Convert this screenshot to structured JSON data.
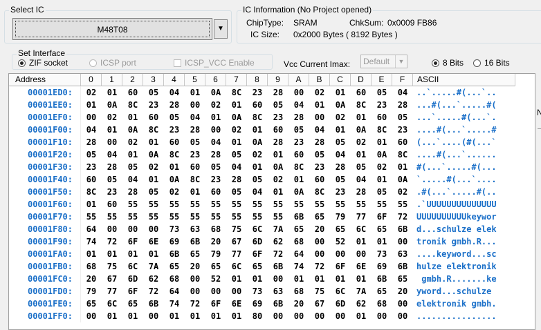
{
  "select_ic": {
    "title": "Select IC",
    "value": "M48T08",
    "dropdown_arrow": "▼"
  },
  "ic_info": {
    "title": "IC Information (No Project opened)",
    "chip_type_label": "ChipType:",
    "chip_type_value": "SRAM",
    "chksum_label": "ChkSum:",
    "chksum_value": "0x0009 FB86",
    "ic_size_label": "IC Size:",
    "ic_size_value": "0x2000 Bytes ( 8192 Bytes )"
  },
  "set_interface": {
    "title": "Set Interface",
    "zif_socket": "ZIF socket",
    "icsp_port": "ICSP port",
    "icsp_vcc": "ICSP_VCC Enable"
  },
  "vcc": {
    "label": "Vcc Current Imax:",
    "value": "Default"
  },
  "bits": {
    "bits8": "8 Bits",
    "bits16": "16 Bits"
  },
  "grid": {
    "header_address": "Address",
    "header_cols": [
      "0",
      "1",
      "2",
      "3",
      "4",
      "5",
      "6",
      "7",
      "8",
      "9",
      "A",
      "B",
      "C",
      "D",
      "E",
      "F"
    ],
    "header_ascii": "ASCII",
    "rows": [
      {
        "addr": "00001ED0:",
        "bytes": [
          "02",
          "01",
          "60",
          "05",
          "04",
          "01",
          "0A",
          "8C",
          "23",
          "28",
          "00",
          "02",
          "01",
          "60",
          "05",
          "04"
        ],
        "ascii": "..`.....#(...`.."
      },
      {
        "addr": "00001EE0:",
        "bytes": [
          "01",
          "0A",
          "8C",
          "23",
          "28",
          "00",
          "02",
          "01",
          "60",
          "05",
          "04",
          "01",
          "0A",
          "8C",
          "23",
          "28"
        ],
        "ascii": "...#(...`.....#("
      },
      {
        "addr": "00001EF0:",
        "bytes": [
          "00",
          "02",
          "01",
          "60",
          "05",
          "04",
          "01",
          "0A",
          "8C",
          "23",
          "28",
          "00",
          "02",
          "01",
          "60",
          "05"
        ],
        "ascii": "...`.....#(...`."
      },
      {
        "addr": "00001F00:",
        "bytes": [
          "04",
          "01",
          "0A",
          "8C",
          "23",
          "28",
          "00",
          "02",
          "01",
          "60",
          "05",
          "04",
          "01",
          "0A",
          "8C",
          "23"
        ],
        "ascii": "....#(...`.....#"
      },
      {
        "addr": "00001F10:",
        "bytes": [
          "28",
          "00",
          "02",
          "01",
          "60",
          "05",
          "04",
          "01",
          "0A",
          "28",
          "23",
          "28",
          "05",
          "02",
          "01",
          "60"
        ],
        "ascii": "(...`....(#(...`"
      },
      {
        "addr": "00001F20:",
        "bytes": [
          "05",
          "04",
          "01",
          "0A",
          "8C",
          "23",
          "28",
          "05",
          "02",
          "01",
          "60",
          "05",
          "04",
          "01",
          "0A",
          "8C"
        ],
        "ascii": "....#(...`......"
      },
      {
        "addr": "00001F30:",
        "bytes": [
          "23",
          "28",
          "05",
          "02",
          "01",
          "60",
          "05",
          "04",
          "01",
          "0A",
          "8C",
          "23",
          "28",
          "05",
          "02",
          "01"
        ],
        "ascii": "#(...`.....#(..."
      },
      {
        "addr": "00001F40:",
        "bytes": [
          "60",
          "05",
          "04",
          "01",
          "0A",
          "8C",
          "23",
          "28",
          "05",
          "02",
          "01",
          "60",
          "05",
          "04",
          "01",
          "0A"
        ],
        "ascii": "`.....#(...`...."
      },
      {
        "addr": "00001F50:",
        "bytes": [
          "8C",
          "23",
          "28",
          "05",
          "02",
          "01",
          "60",
          "05",
          "04",
          "01",
          "0A",
          "8C",
          "23",
          "28",
          "05",
          "02"
        ],
        "ascii": ".#(...`.....#(.."
      },
      {
        "addr": "00001F60:",
        "bytes": [
          "01",
          "60",
          "55",
          "55",
          "55",
          "55",
          "55",
          "55",
          "55",
          "55",
          "55",
          "55",
          "55",
          "55",
          "55",
          "55"
        ],
        "ascii": ".`UUUUUUUUUUUUUU"
      },
      {
        "addr": "00001F70:",
        "bytes": [
          "55",
          "55",
          "55",
          "55",
          "55",
          "55",
          "55",
          "55",
          "55",
          "55",
          "6B",
          "65",
          "79",
          "77",
          "6F",
          "72"
        ],
        "ascii": "UUUUUUUUUUkeywor"
      },
      {
        "addr": "00001F80:",
        "bytes": [
          "64",
          "00",
          "00",
          "00",
          "73",
          "63",
          "68",
          "75",
          "6C",
          "7A",
          "65",
          "20",
          "65",
          "6C",
          "65",
          "6B"
        ],
        "ascii": "d...schulze elek"
      },
      {
        "addr": "00001F90:",
        "bytes": [
          "74",
          "72",
          "6F",
          "6E",
          "69",
          "6B",
          "20",
          "67",
          "6D",
          "62",
          "68",
          "00",
          "52",
          "01",
          "01",
          "00"
        ],
        "ascii": "tronik gmbh.R..."
      },
      {
        "addr": "00001FA0:",
        "bytes": [
          "01",
          "01",
          "01",
          "01",
          "6B",
          "65",
          "79",
          "77",
          "6F",
          "72",
          "64",
          "00",
          "00",
          "00",
          "73",
          "63"
        ],
        "ascii": "....keyword...sc"
      },
      {
        "addr": "00001FB0:",
        "bytes": [
          "68",
          "75",
          "6C",
          "7A",
          "65",
          "20",
          "65",
          "6C",
          "65",
          "6B",
          "74",
          "72",
          "6F",
          "6E",
          "69",
          "6B"
        ],
        "ascii": "hulze elektronik"
      },
      {
        "addr": "00001FC0:",
        "bytes": [
          "20",
          "67",
          "6D",
          "62",
          "68",
          "00",
          "52",
          "01",
          "01",
          "00",
          "01",
          "01",
          "01",
          "01",
          "6B",
          "65"
        ],
        "ascii": " gmbh.R.......ke"
      },
      {
        "addr": "00001FD0:",
        "bytes": [
          "79",
          "77",
          "6F",
          "72",
          "64",
          "00",
          "00",
          "00",
          "73",
          "63",
          "68",
          "75",
          "6C",
          "7A",
          "65",
          "20"
        ],
        "ascii": "yword...schulze "
      },
      {
        "addr": "00001FE0:",
        "bytes": [
          "65",
          "6C",
          "65",
          "6B",
          "74",
          "72",
          "6F",
          "6E",
          "69",
          "6B",
          "20",
          "67",
          "6D",
          "62",
          "68",
          "00"
        ],
        "ascii": "elektronik gmbh."
      },
      {
        "addr": "00001FF0:",
        "bytes": [
          "00",
          "01",
          "01",
          "00",
          "01",
          "01",
          "01",
          "01",
          "80",
          "00",
          "00",
          "00",
          "00",
          "01",
          "00",
          "00"
        ],
        "ascii": "................"
      }
    ]
  },
  "edge_text": "N",
  "colors": {
    "address": "#1a6fc8",
    "ascii": "#1a6fc8"
  }
}
